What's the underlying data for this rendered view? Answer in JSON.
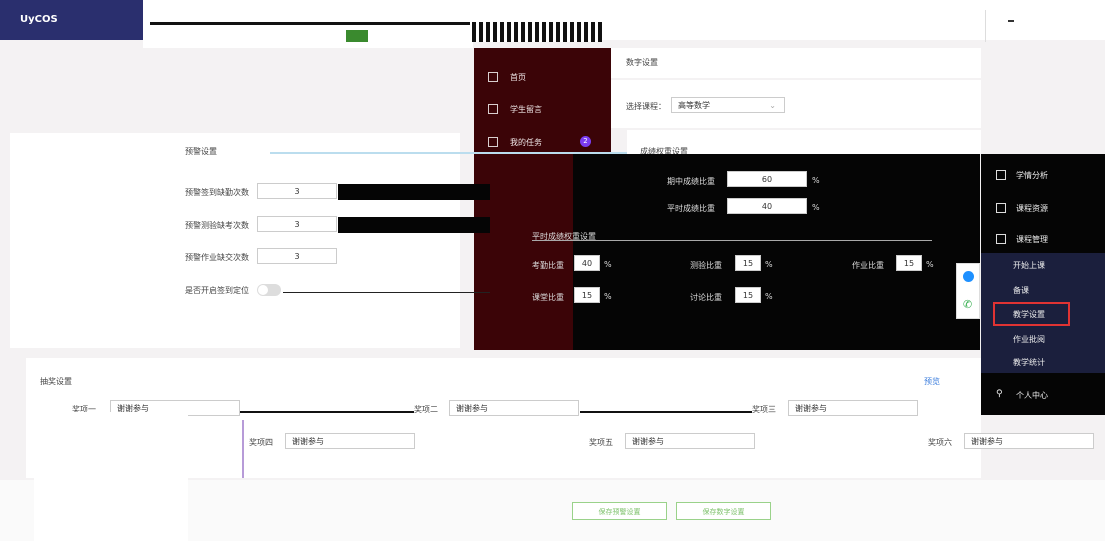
{
  "app": {
    "logo": "UyCOS",
    "page_title": "数字设置"
  },
  "course_select": {
    "label": "选择课程：",
    "value": "高等数学"
  },
  "left_nav": {
    "items": [
      {
        "label": "首页"
      },
      {
        "label": "学生留言"
      },
      {
        "label": "我的任务",
        "badge": "2"
      }
    ]
  },
  "warning_settings": {
    "title": "预警设置",
    "rows": [
      {
        "label": "预警签到缺勤次数",
        "value": "3"
      },
      {
        "label": "预警测验缺考次数",
        "value": "3"
      },
      {
        "label": "预警作业缺交次数",
        "value": "3"
      }
    ],
    "signin_label": "是否开启签到定位"
  },
  "score_settings": {
    "title": "成绩权重设置",
    "usual_rows": [
      {
        "label": "期中成绩比重",
        "value": "60",
        "unit": "%"
      },
      {
        "label": "平时成绩比重",
        "value": "40",
        "unit": "%"
      }
    ],
    "usual_title": "平时成绩权重设置",
    "weights": [
      {
        "label": "考勤比重",
        "value": "40",
        "unit": "%"
      },
      {
        "label": "测验比重",
        "value": "15",
        "unit": "%"
      },
      {
        "label": "作业比重",
        "value": "15",
        "unit": "%"
      },
      {
        "label": "课堂比重",
        "value": "15",
        "unit": "%"
      },
      {
        "label": "讨论比重",
        "value": "15",
        "unit": "%"
      }
    ]
  },
  "right_menu": {
    "items": [
      {
        "label": "学情分析"
      },
      {
        "label": "课程资源"
      },
      {
        "label": "课程管理"
      }
    ],
    "sub_items": [
      {
        "label": "开始上课"
      },
      {
        "label": "备课"
      },
      {
        "label": "教学设置"
      },
      {
        "label": "作业批阅"
      },
      {
        "label": "教学统计"
      }
    ],
    "user_center": "个人中心"
  },
  "lottery": {
    "title": "抽奖设置",
    "preview": "预览",
    "prizes": [
      {
        "label": "奖项一",
        "value": "谢谢参与"
      },
      {
        "label": "奖项二",
        "value": "谢谢参与"
      },
      {
        "label": "奖项三",
        "value": "谢谢参与"
      },
      {
        "label": "奖项四",
        "value": "谢谢参与"
      },
      {
        "label": "奖项五",
        "value": "谢谢参与"
      },
      {
        "label": "奖项六",
        "value": "谢谢参与"
      }
    ]
  },
  "buttons": {
    "save": "保存预警设置",
    "save_all": "保存数字设置"
  }
}
